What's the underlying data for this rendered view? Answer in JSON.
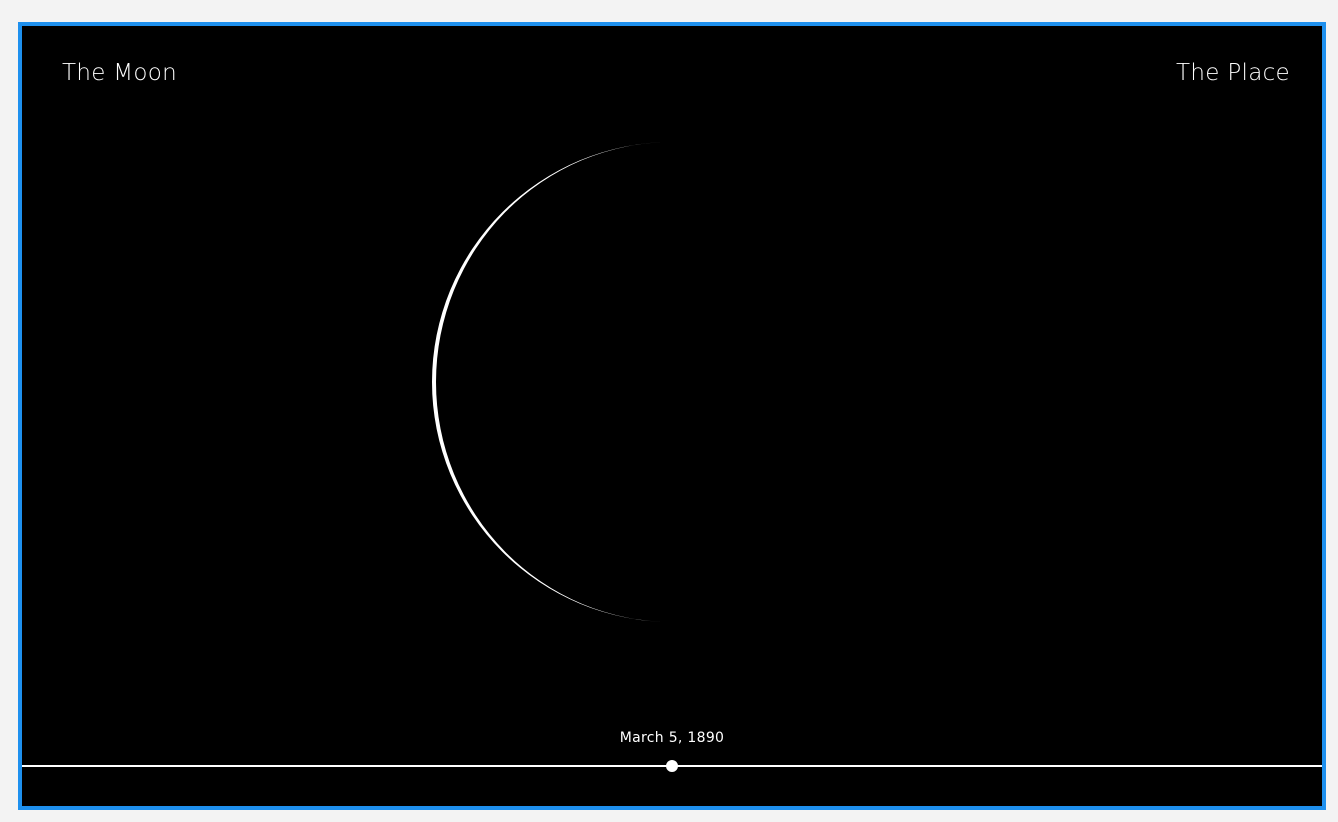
{
  "header": {
    "title_left": "The Moon",
    "title_right": "The Place"
  },
  "timeline": {
    "date": "March 5, 1890",
    "position": 0.5
  },
  "colors": {
    "frame_border": "#1e90ee",
    "background": "#000000",
    "foreground": "#ffffff"
  }
}
